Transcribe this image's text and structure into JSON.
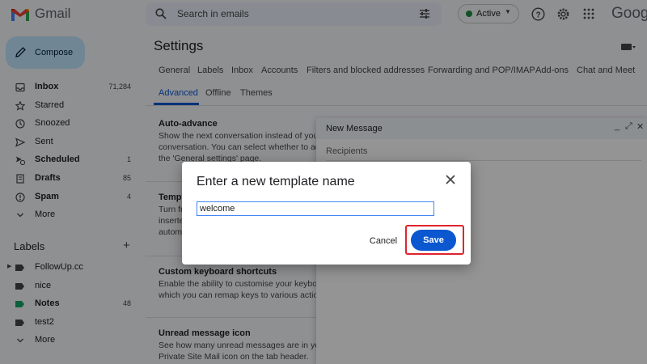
{
  "app": {
    "name": "Gmail",
    "brand_partial": "Goog"
  },
  "search": {
    "placeholder": "Search in emails"
  },
  "status": {
    "label": "Active",
    "color": "#1e8e3e"
  },
  "sidebar": {
    "compose_label": "Compose",
    "items": [
      {
        "label": "Inbox",
        "count": "71,284",
        "bold": true,
        "icon": "inbox-icon"
      },
      {
        "label": "Starred",
        "count": "",
        "bold": false,
        "icon": "star-icon"
      },
      {
        "label": "Snoozed",
        "count": "",
        "bold": false,
        "icon": "clock-icon"
      },
      {
        "label": "Sent",
        "count": "",
        "bold": false,
        "icon": "send-icon"
      },
      {
        "label": "Scheduled",
        "count": "1",
        "bold": true,
        "icon": "scheduled-icon"
      },
      {
        "label": "Drafts",
        "count": "85",
        "bold": true,
        "icon": "draft-icon"
      },
      {
        "label": "Spam",
        "count": "4",
        "bold": true,
        "icon": "spam-icon"
      },
      {
        "label": "More",
        "count": "",
        "bold": false,
        "icon": "chevron-down-icon"
      }
    ],
    "labels_heading": "Labels",
    "labels": [
      {
        "label": "FollowUp.cc",
        "count": "",
        "bold": false,
        "color": "#444746"
      },
      {
        "label": "nice",
        "count": "",
        "bold": false,
        "color": "#444746"
      },
      {
        "label": "Notes",
        "count": "48",
        "bold": true,
        "color": "#16a765"
      },
      {
        "label": "test2",
        "count": "",
        "bold": false,
        "color": "#444746"
      },
      {
        "label": "More",
        "count": "",
        "bold": false,
        "color": ""
      }
    ]
  },
  "settings": {
    "title": "Settings",
    "tabs_row1": [
      "General",
      "Labels",
      "Inbox",
      "Accounts",
      "Filters and blocked addresses",
      "Forwarding and POP/IMAP",
      "Add-ons",
      "Chat and Meet"
    ],
    "tabs_row2": [
      "Advanced",
      "Offline",
      "Themes"
    ],
    "active_tab": "Advanced",
    "sections": [
      {
        "title": "Auto-advance",
        "lines": [
          "Show the next conversation instead of your",
          "conversation. You can select whether to adv",
          "the 'General settings' page."
        ]
      },
      {
        "title": "Templ",
        "lines": [
          "Turn fr",
          "inserte",
          "autom"
        ]
      },
      {
        "title": "Custom keyboard shortcuts",
        "lines": [
          "Enable the ability to customise your keyboa",
          "which you can remap keys to various action"
        ]
      },
      {
        "title": "Unread message icon",
        "lines": [
          "See how many unread messages are in your",
          "Private Site Mail icon on the tab header."
        ]
      }
    ]
  },
  "compose_window": {
    "title": "New Message",
    "recipients_placeholder": "Recipients",
    "minimize": "_",
    "expand": "⤢",
    "close": "✕"
  },
  "dialog": {
    "title": "Enter a new template name",
    "input_value": "welcome",
    "cancel_label": "Cancel",
    "save_label": "Save"
  },
  "colors": {
    "accent": "#0b57d0",
    "compose_bg": "#c2e7ff",
    "highlight": "#e0242d"
  }
}
